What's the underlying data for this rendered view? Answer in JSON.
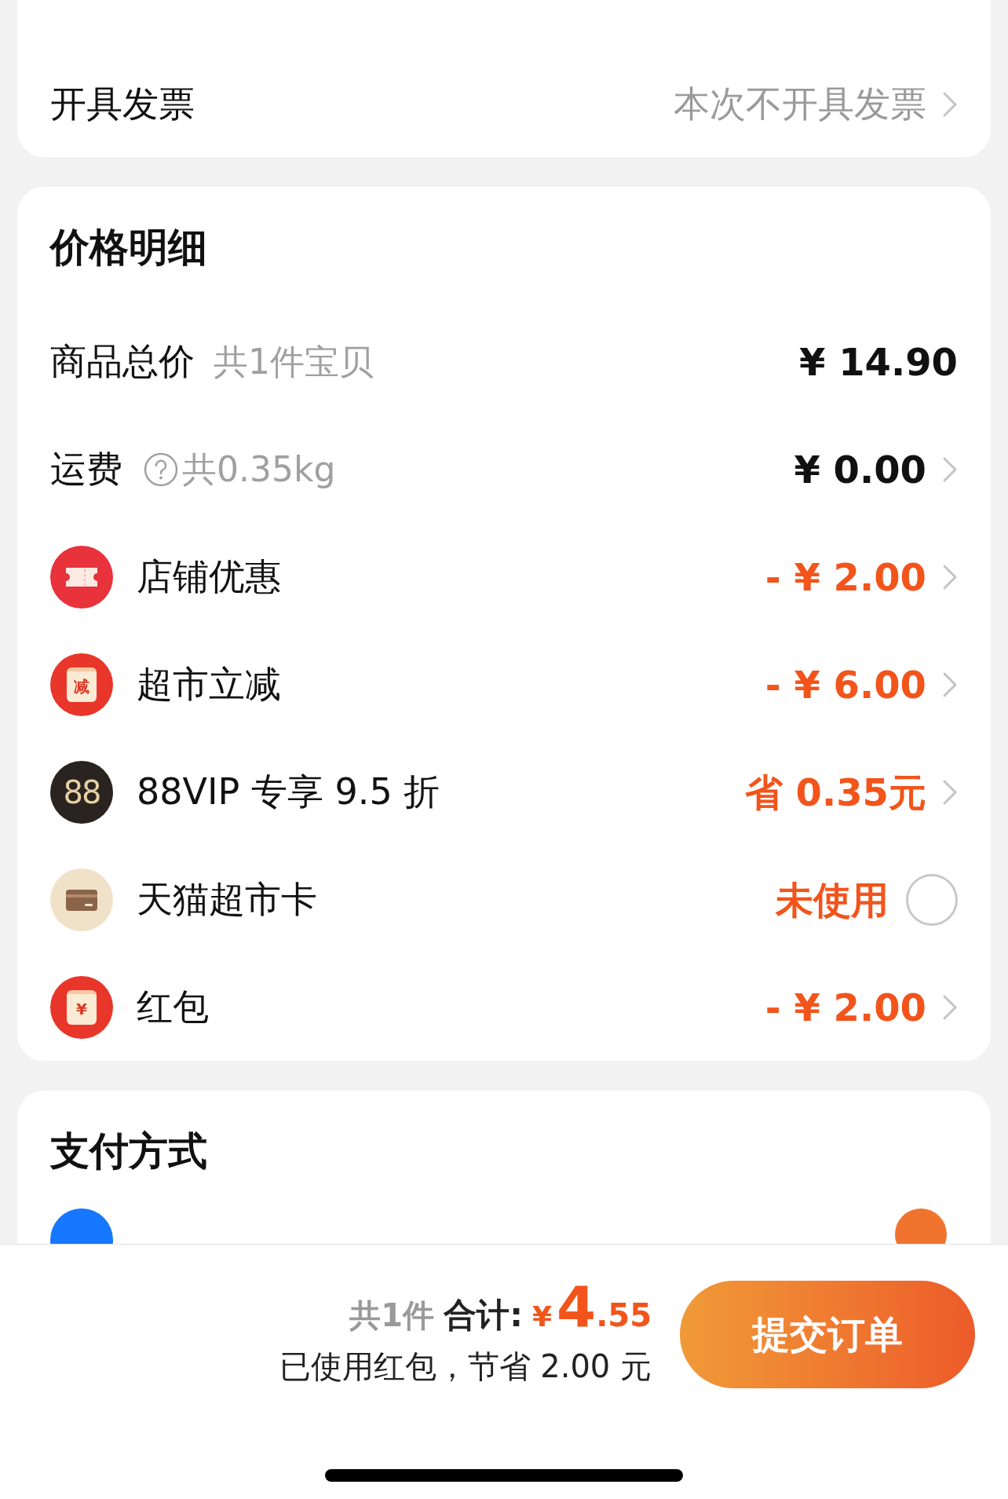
{
  "invoice_row": {
    "label": "开具发票",
    "value": "本次不开具发票"
  },
  "price_details": {
    "title": "价格明细",
    "rows": [
      {
        "kind": "total",
        "label": "商品总价",
        "note": "共1件宝贝",
        "value": "¥ 14.90"
      },
      {
        "kind": "shipping",
        "label": "运费",
        "note": "共0.35kg",
        "value": "¥ 0.00"
      },
      {
        "kind": "ticket",
        "label": "店铺优惠",
        "value": "- ¥ 2.00"
      },
      {
        "kind": "reduce",
        "badge": "减",
        "label": "超市立减",
        "value": "- ¥ 6.00"
      },
      {
        "kind": "vip",
        "badge": "88",
        "label": "88VIP 专享 9.5 折",
        "value": "省 0.35元"
      },
      {
        "kind": "card",
        "label": "天猫超市卡",
        "value": "未使用",
        "checked": false
      },
      {
        "kind": "redpacket",
        "badge": "¥",
        "label": "红包",
        "value": "- ¥ 2.00"
      }
    ]
  },
  "payment": {
    "title": "支付方式"
  },
  "footer": {
    "count": "共1件",
    "total_label": "合计:",
    "currency": "¥",
    "integer": "4",
    "decimal": ".55",
    "savings": "已使用红包，节省 2.00 元",
    "submit": "提交订单"
  }
}
